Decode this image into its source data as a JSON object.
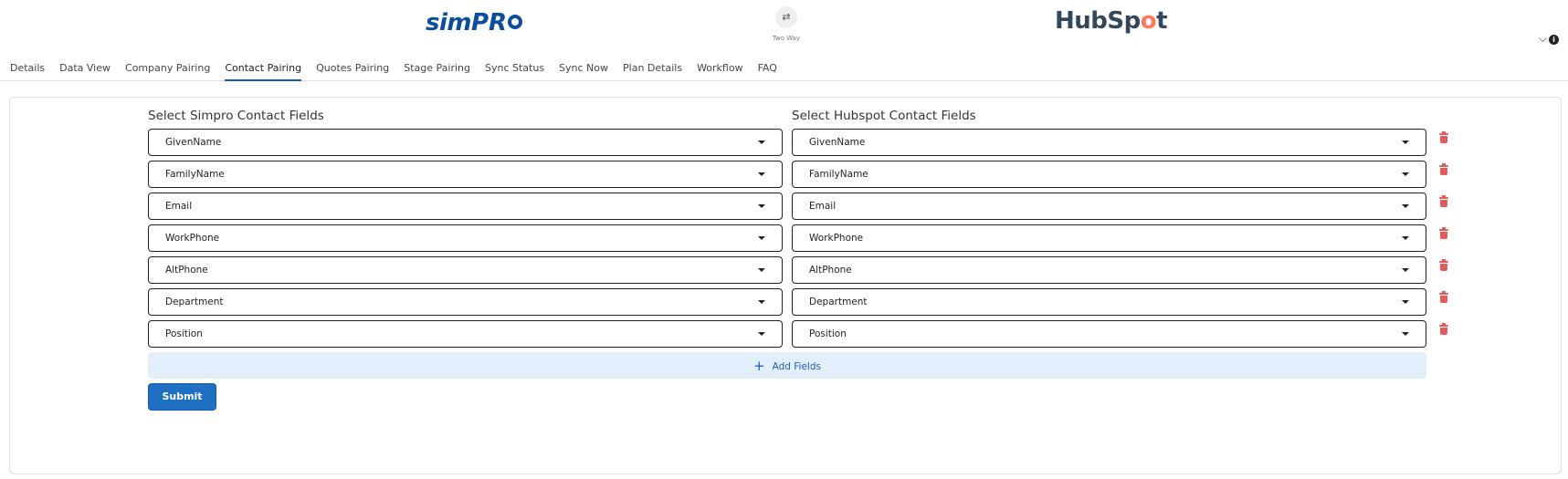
{
  "header": {
    "logo_left": {
      "sim": "sim",
      "pro": "PR"
    },
    "sync_icon": "⇄",
    "sync_label": "Two Way",
    "logo_right": {
      "hub": "HubSp",
      "sprocket": "o",
      "end": "t"
    },
    "corner_chevron": "⌵",
    "corner_info": "i"
  },
  "tabs": [
    {
      "label": "Details"
    },
    {
      "label": "Data View"
    },
    {
      "label": "Company Pairing"
    },
    {
      "label": "Contact Pairing",
      "active": true
    },
    {
      "label": "Quotes Pairing"
    },
    {
      "label": "Stage Pairing"
    },
    {
      "label": "Sync Status"
    },
    {
      "label": "Sync Now"
    },
    {
      "label": "Plan Details"
    },
    {
      "label": "Workflow"
    },
    {
      "label": "FAQ"
    }
  ],
  "form": {
    "left_heading": "Select Simpro Contact Fields",
    "right_heading": "Select Hubspot Contact Fields",
    "rows": [
      {
        "simpro": "GivenName",
        "hubspot": "GivenName"
      },
      {
        "simpro": "FamilyName",
        "hubspot": "FamilyName"
      },
      {
        "simpro": "Email",
        "hubspot": "Email"
      },
      {
        "simpro": "WorkPhone",
        "hubspot": "WorkPhone"
      },
      {
        "simpro": "AltPhone",
        "hubspot": "AltPhone"
      },
      {
        "simpro": "Department",
        "hubspot": "Department"
      },
      {
        "simpro": "Position",
        "hubspot": "Position"
      }
    ],
    "add_fields_icon": "+",
    "add_fields_label": "Add Fields",
    "submit_label": "Submit"
  },
  "colors": {
    "accent": "#1f6fc3",
    "delete": "#e35b5b",
    "add_bg": "#e3eefb"
  }
}
